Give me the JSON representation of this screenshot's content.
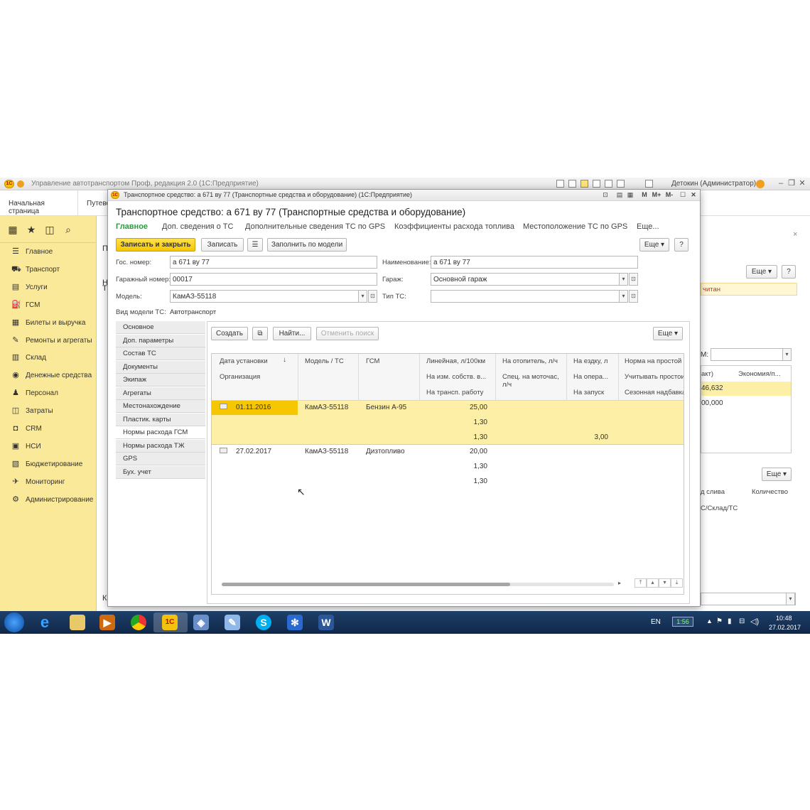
{
  "app": {
    "title": "Управление автотранспортом Проф, редакция 2.0  (1С:Предприятие)",
    "user": "Детокин (Администратор)"
  },
  "tabs": [
    "Начальная страница",
    "Путево"
  ],
  "sidebar": {
    "items": [
      {
        "label": "Главное",
        "icon": "menu-icon"
      },
      {
        "label": "Транспорт",
        "icon": "truck-icon"
      },
      {
        "label": "Услуги",
        "icon": "services-icon"
      },
      {
        "label": "ГСМ",
        "icon": "fuel-icon"
      },
      {
        "label": "Билеты и выручка",
        "icon": "tickets-icon"
      },
      {
        "label": "Ремонты и агрегаты",
        "icon": "wrench-icon"
      },
      {
        "label": "Склад",
        "icon": "warehouse-icon"
      },
      {
        "label": "Денежные средства",
        "icon": "money-icon"
      },
      {
        "label": "Персонал",
        "icon": "people-icon"
      },
      {
        "label": "Затраты",
        "icon": "costs-icon"
      },
      {
        "label": "CRM",
        "icon": "crm-icon"
      },
      {
        "label": "НСИ",
        "icon": "reference-icon"
      },
      {
        "label": "Бюджетирование",
        "icon": "budget-icon"
      },
      {
        "label": "Мониторинг",
        "icon": "monitoring-icon"
      },
      {
        "label": "Администрирование",
        "icon": "gear-icon"
      }
    ]
  },
  "background": {
    "more_label": "Еще",
    "help_label": "?",
    "status_text": "читан",
    "m_label": "М:",
    "col_fact": "акт)",
    "col_economy": "Экономия/п...",
    "val1": "46,632",
    "val2": "00,000",
    "more2_label": "Еще",
    "col_drain": "д слива",
    "col_qty": "Количество",
    "col_store": "С/Склад/ТС",
    "k_label": "К",
    "n_label": "Н",
    "t_label": "Т",
    "p_label": "П"
  },
  "form": {
    "window_title": "Транспортное средство: а 671 ву 77 (Транспортные средства и оборудование)  (1С:Предприятие)",
    "window_buttons": [
      "M",
      "M+",
      "M-"
    ],
    "heading": "Транспортное средство: а 671 ву 77 (Транспортные средства и оборудование)",
    "nav_links": [
      "Главное",
      "Доп. сведения о ТС",
      "Дополнительные сведения ТС по GPS",
      "Коэффициенты расхода топлива",
      "Местоположение ТС по GPS",
      "Еще..."
    ],
    "toolbar": {
      "save_close": "Записать и закрыть",
      "save": "Записать",
      "fill_by_model": "Заполнить по модели",
      "more": "Еще",
      "help": "?"
    },
    "fields": {
      "gos_nomer_label": "Гос. номер:",
      "gos_nomer_value": "а 671 ву 77",
      "name_label": "Наименование:",
      "name_value": "а 671 ву 77",
      "garage_num_label": "Гаражный номер:",
      "garage_num_value": "00017",
      "garage_label": "Гараж:",
      "garage_value": "Основной гараж",
      "model_label": "Модель:",
      "model_value": "КамАЗ-55118",
      "type_label": "Тип ТС:",
      "type_value": "",
      "model_kind_label": "Вид модели ТС:",
      "model_kind_value": "Автотранспорт"
    },
    "sections": [
      "Основное",
      "Доп. параметры",
      "Состав ТС",
      "Документы",
      "Экипаж",
      "Агрегаты",
      "Местонахождение",
      "Пластик. карты",
      "Нормы расхода ГСМ",
      "Нормы расхода ТЖ",
      "GPS",
      "Бух. учет"
    ],
    "active_section": "Нормы расхода ГСМ",
    "table_toolbar": {
      "create": "Создать",
      "find": "Найти...",
      "cancel_search": "Отменить поиск",
      "more": "Еще"
    },
    "table": {
      "headers": {
        "date": "Дата установки",
        "org": "Организация",
        "model": "Модель / ТС",
        "fuel": "ГСМ",
        "linear": "Линейная, л/100км",
        "own": "На изм. собств. в...",
        "transp": "На трансп. работу",
        "heater": "На отопитель, л/ч",
        "spec": "Спец. на моточас, л/ч",
        "ride": "На ездку, л",
        "oper": "На опера...",
        "start": "На запуск",
        "idle": "Норма на простой",
        "idle_count": "Учитывать простои",
        "season": "Сезонная надбавка"
      },
      "rows": [
        {
          "date": "01.11.2016",
          "model": "КамАЗ-55118",
          "fuel": "Бензин А-95",
          "linear": "25,00",
          "own": "1,30",
          "transp": "1,30",
          "start": "3,00",
          "selected": true
        },
        {
          "date": "27.02.2017",
          "model": "КамАЗ-55118",
          "fuel": "Дизтопливо",
          "linear": "20,00",
          "own": "1,30",
          "transp": "1,30",
          "start": "",
          "selected": false
        }
      ]
    }
  },
  "taskbar": {
    "lang": "EN",
    "battery": "1:56",
    "time": "10:48",
    "date": "27.02.2017"
  },
  "colors": {
    "sidebar": "#fbe99a",
    "selected_row": "#fdf0a6",
    "primary_button": "#f6c600",
    "active_link": "#2a9b3c",
    "taskbar": "#10284a"
  }
}
